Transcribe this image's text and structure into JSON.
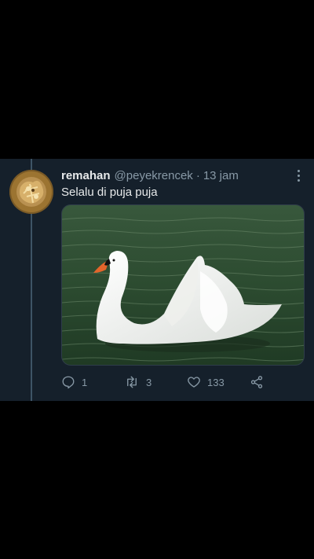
{
  "tweet": {
    "display_name": "remahan",
    "handle": "@peyekrencek",
    "separator": "·",
    "time": "13 jam",
    "text": "Selalu di puja puja",
    "media": {
      "subject": "swan-photo"
    },
    "stats": {
      "replies": "1",
      "retweets": "3",
      "likes": "133"
    }
  },
  "icons": {
    "reply": "reply-icon",
    "retweet": "retweet-icon",
    "like": "heart-icon",
    "share": "share-icon",
    "more": "more-options-icon"
  },
  "colors": {
    "background": "#000000",
    "card": "#15202b",
    "primary_text": "#e7e9ea",
    "secondary_text": "#8899a6"
  }
}
